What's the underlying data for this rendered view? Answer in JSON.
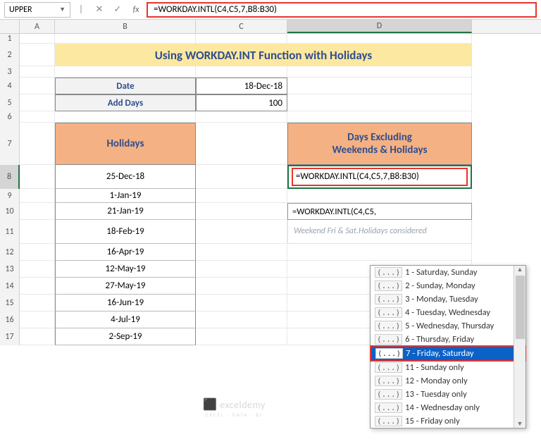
{
  "namebox": "UPPER",
  "formula_bar": "=WORKDAY.INTL(C4,C5,7,B8:B30)",
  "cols": [
    "A",
    "B",
    "C",
    "D"
  ],
  "rows": [
    "1",
    "2",
    "3",
    "4",
    "5",
    "6",
    "7",
    "8",
    "9",
    "10",
    "11",
    "12",
    "13",
    "14",
    "15",
    "16",
    "17"
  ],
  "title": "Using WORKDAY.INT Function with Holidays",
  "labels": {
    "date": "Date",
    "add_days": "Add Days",
    "holidays": "Holidays",
    "days_ex": "Days Excluding\nWeekends & Holidays"
  },
  "values": {
    "date": "18-Dec-18",
    "add_days": "100"
  },
  "holidays": [
    "25-Dec-18",
    "1-Jan-19",
    "21-Jan-19",
    "18-Feb-19",
    "16-Apr-19",
    "12-May-19",
    "27-May-19",
    "16-Jun-19",
    "4-Jul-19",
    "2-Sep-19"
  ],
  "cell_formula": "=WORKDAY.INTL(C4,C5,7,B8:B30)",
  "pending_formula": "=WORKDAY.INTL(C4,C5,",
  "note_line1": "Weekend Fri & Sat.",
  "note_line2": "Holidays considered",
  "dropdown": [
    {
      "t": "1 - Saturday, Sunday"
    },
    {
      "t": "2 - Sunday, Monday"
    },
    {
      "t": "3 - Monday, Tuesday"
    },
    {
      "t": "4 - Tuesday, Wednesday"
    },
    {
      "t": "5 - Wednesday, Thursday"
    },
    {
      "t": "6 - Thursday, Friday"
    },
    {
      "t": "7 - Friday, Saturday",
      "sel": true
    },
    {
      "t": "11 - Sunday only"
    },
    {
      "t": "12 - Monday only"
    },
    {
      "t": "13 - Tuesday only"
    },
    {
      "t": "14 - Wednesday only"
    },
    {
      "t": "15 - Friday only"
    }
  ],
  "watermark": "exceldemy",
  "watermark_sub": "EXCEL · DATA · BI"
}
